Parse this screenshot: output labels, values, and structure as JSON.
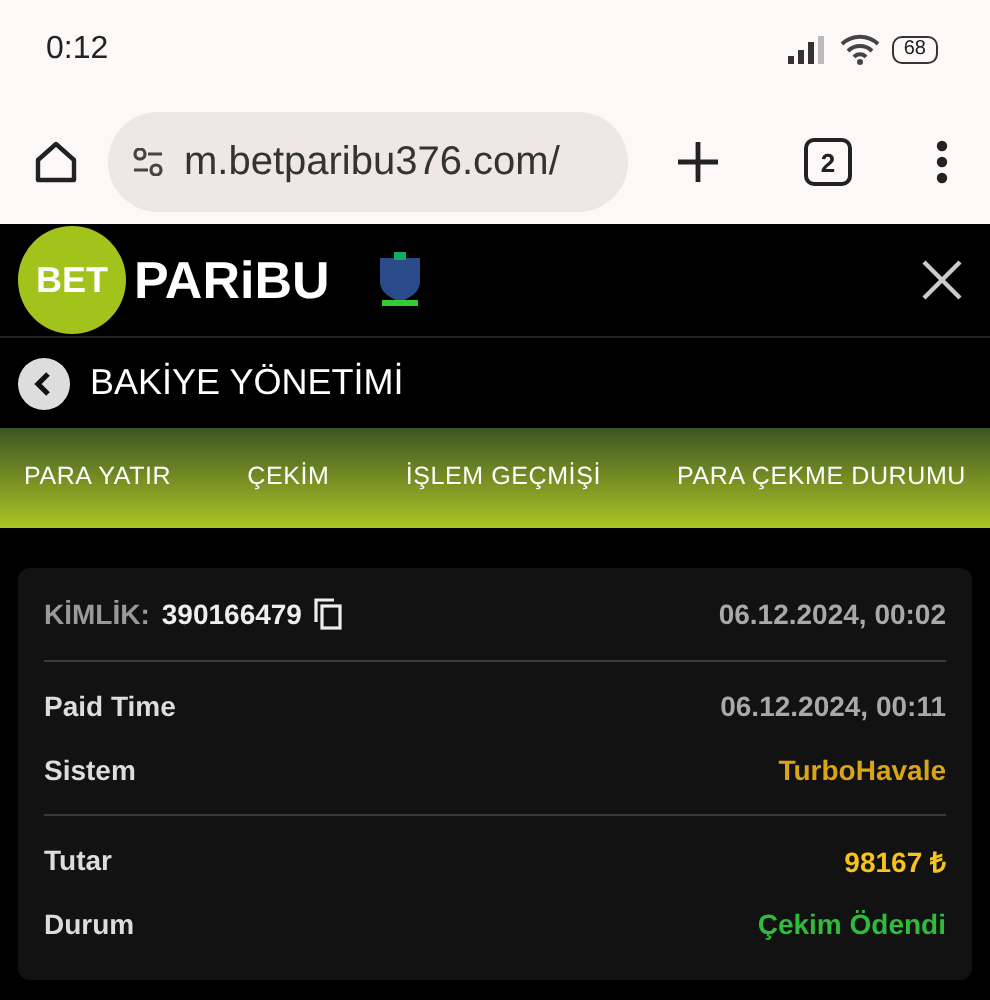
{
  "status_bar": {
    "time": "0:12",
    "battery": "68"
  },
  "browser": {
    "url": "m.betparibu376.com/",
    "tab_count": "2"
  },
  "header": {
    "logo_badge": "BET",
    "logo_text": "PARiBU"
  },
  "page_title": "BAKİYE YÖNETİMİ",
  "tabs": [
    {
      "label": "PARA YATIR",
      "selected": false
    },
    {
      "label": "ÇEKİM",
      "selected": false
    },
    {
      "label": "İŞLEM GEÇMİŞİ",
      "selected": false
    },
    {
      "label": "PARA ÇEKME DURUMU",
      "selected": false
    }
  ],
  "card": {
    "id_label": "KİMLİK:",
    "id_value": "390166479",
    "created": "06.12.2024, 00:02",
    "sections": [
      [
        {
          "label": "Paid Time",
          "value": "06.12.2024, 00:11",
          "kind": "muted"
        },
        {
          "label": "Sistem",
          "value": "TurboHavale",
          "kind": "system"
        }
      ],
      [
        {
          "label": "Tutar",
          "value": "98167 ₺",
          "kind": "amount"
        },
        {
          "label": "Durum",
          "value": "Çekim Ödendi",
          "kind": "success"
        }
      ]
    ]
  }
}
